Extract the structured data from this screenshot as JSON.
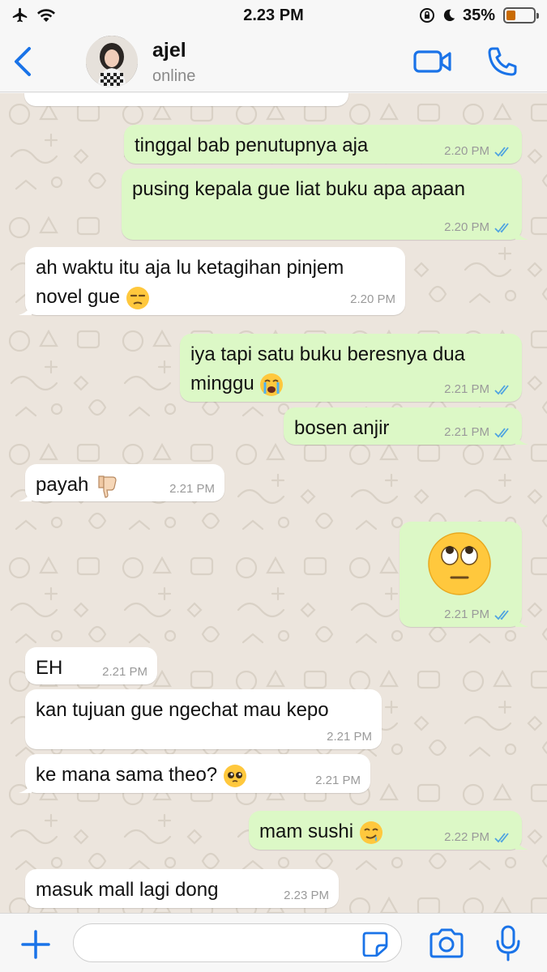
{
  "status_bar": {
    "time": "2.23 PM",
    "battery_percent": "35%",
    "battery_level": 0.35,
    "icons": [
      "airplane-icon",
      "wifi-icon",
      "rotation-lock-icon",
      "moon-icon",
      "battery-icon"
    ]
  },
  "header": {
    "contact_name": "ajel",
    "contact_status": "online",
    "icons": [
      "back-chevron-icon",
      "video-call-icon",
      "phone-icon"
    ],
    "accent_color": "#1a73e8"
  },
  "messages": [
    {
      "dir": "out",
      "text": "tinggal bab penutupnya aja",
      "time": "2.20 PM",
      "read": true
    },
    {
      "dir": "out",
      "text": "pusing kepala gue liat buku apa apaan",
      "time": "2.20 PM",
      "read": true
    },
    {
      "dir": "in",
      "text": "ah waktu itu aja lu ketagihan pinjem\nnovel gue",
      "emoji": "unamused-face",
      "time": "2.20 PM"
    },
    {
      "dir": "out",
      "text": "iya tapi satu buku beresnya dua\nminggu",
      "emoji": "loudly-crying-face",
      "time": "2.21 PM",
      "read": true
    },
    {
      "dir": "out",
      "text": "bosen anjir",
      "time": "2.21 PM",
      "read": true
    },
    {
      "dir": "in",
      "text": "payah",
      "emoji": "thumbs-down",
      "time": "2.21 PM"
    },
    {
      "dir": "out",
      "text": "",
      "emoji": "face-with-rolling-eyes",
      "time": "2.21 PM",
      "read": true
    },
    {
      "dir": "in",
      "text": "EH",
      "time": "2.21 PM"
    },
    {
      "dir": "in",
      "text": "kan tujuan gue ngechat mau kepo",
      "time": "2.21 PM"
    },
    {
      "dir": "in",
      "text": "ke mana sama theo?",
      "emoji": "pleading-face",
      "time": "2.21 PM"
    },
    {
      "dir": "out",
      "text": "mam sushi",
      "emoji": "drooling-face",
      "time": "2.22 PM",
      "read": true
    },
    {
      "dir": "in",
      "text": "masuk mall lagi dong",
      "time": "2.23 PM"
    }
  ],
  "input_bar": {
    "placeholder": "",
    "icons": [
      "plus-icon",
      "sticker-icon",
      "camera-icon",
      "microphone-icon"
    ]
  },
  "colors": {
    "outgoing_bubble": "#dcf8c6",
    "incoming_bubble": "#ffffff",
    "chat_background": "#ece5dd",
    "read_ticks": "#4fa3e0"
  }
}
